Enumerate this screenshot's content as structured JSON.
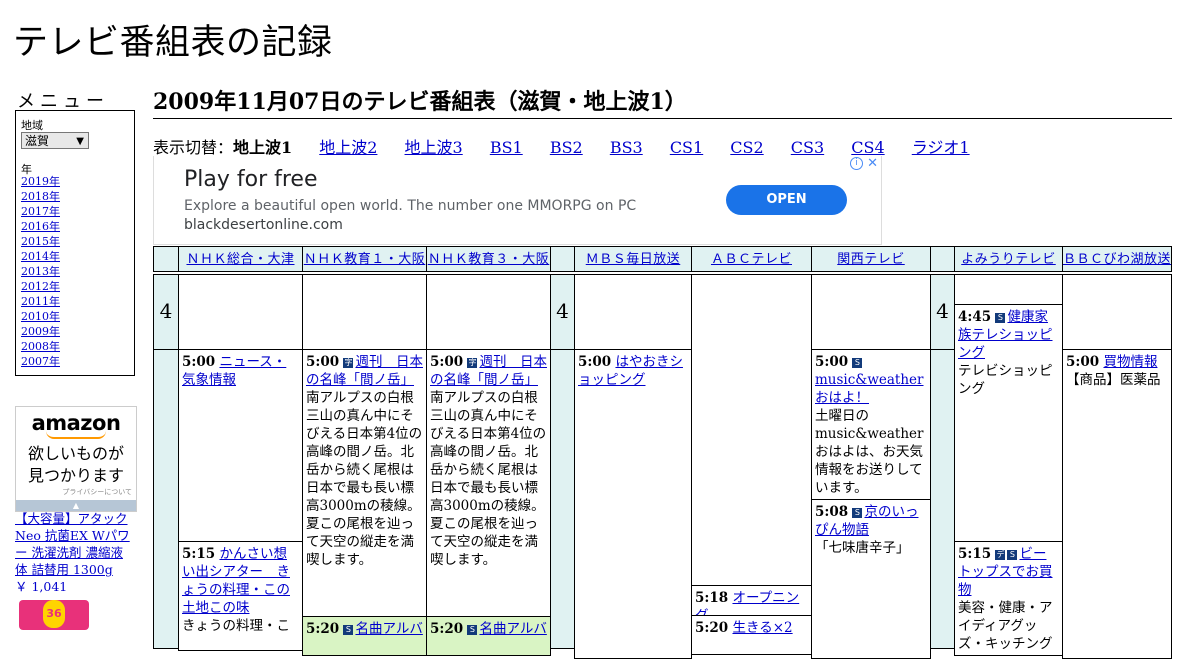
{
  "site_title": "テレビ番組表の記録",
  "menu": {
    "label": "メニュー",
    "region_label": "地域",
    "region_value": "滋賀",
    "year_label": "年",
    "years": [
      "2019年",
      "2018年",
      "2017年",
      "2016年",
      "2015年",
      "2014年",
      "2013年",
      "2012年",
      "2011年",
      "2010年",
      "2009年",
      "2008年",
      "2007年"
    ]
  },
  "amazon_ad": {
    "logo": "amazon",
    "copy_line1": "欲しいものが",
    "copy_line2": "見つかります",
    "privacy": "プライバシーについて",
    "product_title": "【大容量】アタック Neo 抗菌EX Wパワー 洗濯洗剤 濃縮液体 詰替用 1300g",
    "product_price": "￥ 1,041",
    "product_badge": "36"
  },
  "page_heading": "2009年11月07日のテレビ番組表（滋賀・地上波1）",
  "switcher": {
    "label": "表示切替：",
    "current": "地上波1",
    "links": [
      "地上波2",
      "地上波3",
      "BS1",
      "BS2",
      "BS3",
      "CS1",
      "CS2",
      "CS3",
      "CS4",
      "ラジオ1"
    ]
  },
  "ad_banner": {
    "title": "Play for free",
    "description": "Explore a beautiful open world. The number one MMORPG on PC",
    "url": "blackdesertonline.com",
    "button": "OPEN"
  },
  "channels": [
    "ＮＨＫ総合・大津",
    "ＮＨＫ教育１・大阪",
    "ＮＨＫ教育３・大阪",
    "ＭＢＳ毎日放送",
    "ＡＢＣテレビ",
    "関西テレビ",
    "よみうりテレビ",
    "ＢＢＣびわ湖放送"
  ],
  "hour": "4",
  "programs": {
    "nhk_g_1": {
      "time": "5:00",
      "title": "ニュース・気象情報"
    },
    "nhk_g_2": {
      "time": "5:15",
      "title": "かんさい想い出シアター　きょうの料理・この土地この味",
      "desc": "きょうの料理・こ"
    },
    "nhk_e1_1": {
      "time": "5:00",
      "title": "週刊　日本の名峰「間ノ岳」",
      "desc": "南アルプスの白根三山の真ん中にそびえる日本第4位の高峰の間ノ岳。北岳から続く尾根は日本で最も長い標高3000mの稜線。夏この尾根を辿って天空の縦走を満喫します。"
    },
    "nhk_e1_2": {
      "time": "5:20",
      "title": "名曲アルバ"
    },
    "nhk_e3_1": {
      "time": "5:00",
      "title": "週刊　日本の名峰「間ノ岳」",
      "desc": "南アルプスの白根三山の真ん中にそびえる日本第4位の高峰の間ノ岳。北岳から続く尾根は日本で最も長い標高3000mの稜線。夏この尾根を辿って天空の縦走を満喫します。"
    },
    "nhk_e3_2": {
      "time": "5:20",
      "title": "名曲アルバ"
    },
    "mbs_1": {
      "time": "5:00",
      "title": "はやおきショッピング"
    },
    "abc_1": {
      "time": "5:18",
      "title": "オープニング"
    },
    "abc_2": {
      "time": "5:20",
      "title": "生きる×2"
    },
    "ktv_1": {
      "time": "5:00",
      "title": "music&weatherおはよ！",
      "desc": "土曜日のmusic&weatherおはよは、お天気情報をお送りしています。"
    },
    "ktv_2": {
      "time": "5:08",
      "title": "京のいっぴん物語",
      "desc": "「七味唐辛子」"
    },
    "ytv_1": {
      "time": "4:45",
      "title": "健康家族テレショッピング",
      "desc": "テレビショッピング"
    },
    "ytv_2": {
      "time": "5:15",
      "title": "ビートップスでお買物",
      "desc": "美容・健康・アイディアグッズ・キッチング"
    },
    "bbc_1": {
      "time": "5:00",
      "title": "買物情報",
      "desc": "【商品】医薬品"
    }
  }
}
